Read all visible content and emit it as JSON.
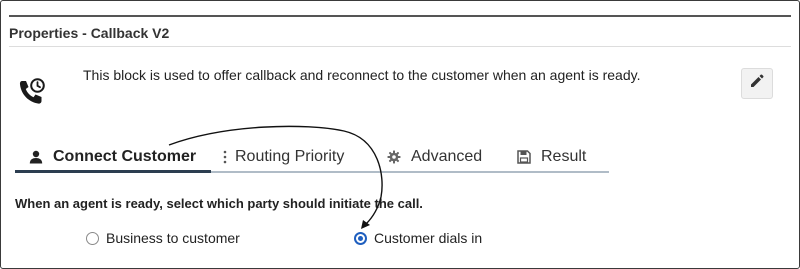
{
  "panel": {
    "title": "Properties - Callback V2",
    "description": "This block is used to offer callback and reconnect to the customer when an agent is ready."
  },
  "icons": {
    "block": "phone-callback-icon",
    "edit": "pencil-icon"
  },
  "tabs": [
    {
      "label": "Connect Customer",
      "icon": "person-icon",
      "active": true
    },
    {
      "label": "Routing Priority",
      "icon": "vertical-dots-icon",
      "active": false
    },
    {
      "label": "Advanced",
      "icon": "gear-icon",
      "active": false
    },
    {
      "label": "Result",
      "icon": "save-icon",
      "active": false
    }
  ],
  "connect_customer": {
    "question": "When an agent is ready, select which party should initiate the call.",
    "options": [
      {
        "label": "Business to customer",
        "selected": false
      },
      {
        "label": "Customer dials in",
        "selected": true
      }
    ]
  },
  "colors": {
    "accent": "#1f5fbf",
    "tab_underline": "#2c3e50",
    "tab_rule": "#b0bcc7"
  }
}
